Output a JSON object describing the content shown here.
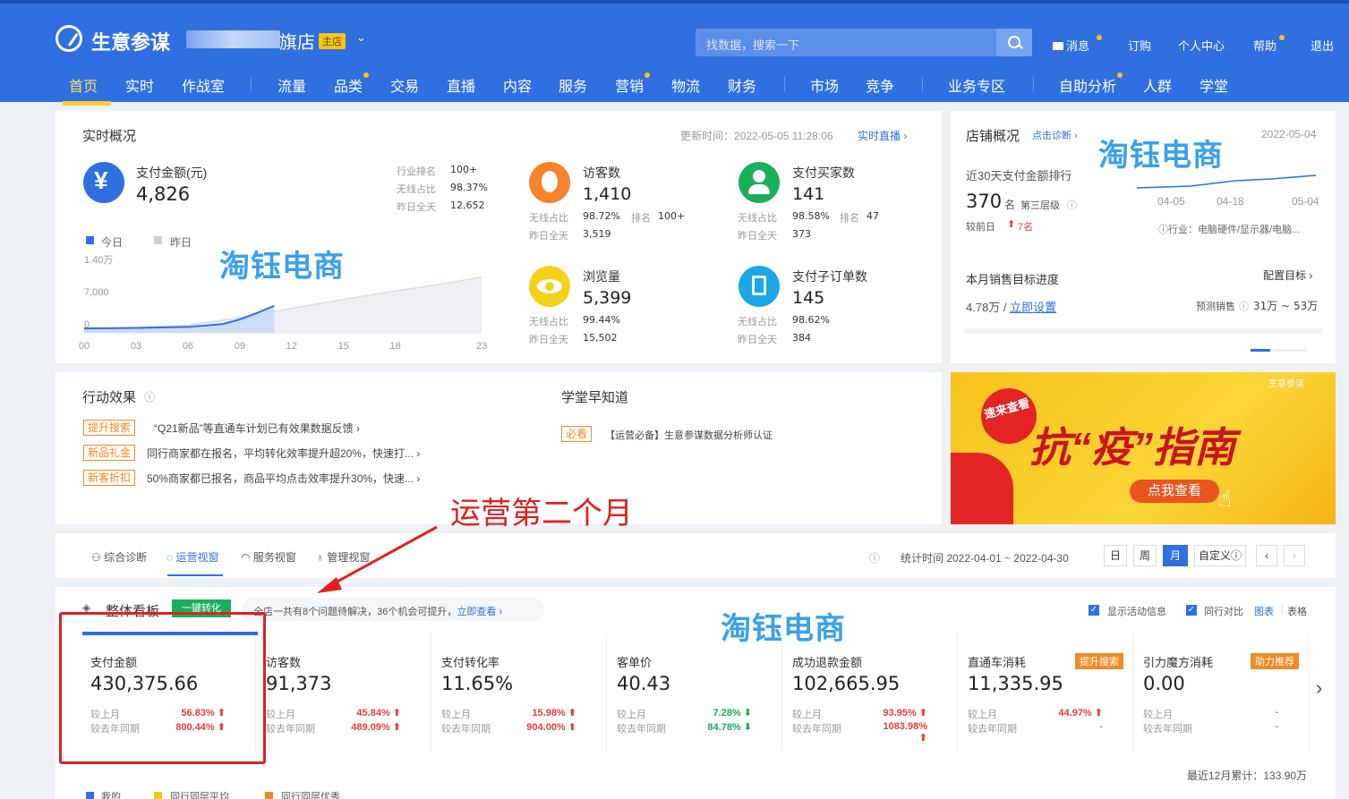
{
  "header": {
    "brand": "生意参谋",
    "shop_name": "旗店",
    "shop_badge": "主店",
    "search_placeholder": "找数据，搜索一下",
    "links": [
      "消息",
      "订购",
      "个人中心",
      "帮助",
      "退出"
    ]
  },
  "nav": [
    "首页",
    "实时",
    "作战室",
    "流量",
    "品类",
    "交易",
    "直播",
    "内容",
    "服务",
    "营销",
    "物流",
    "财务",
    "市场",
    "竞争",
    "业务专区",
    "自助分析",
    "人群",
    "学堂"
  ],
  "realtime": {
    "title": "实时概况",
    "update_label": "更新时间：2022-05-05 11:28:06",
    "live_link": "实时直播 ›",
    "pay": {
      "label": "支付金额(元)",
      "value": "4,826",
      "r1k": "行业排名",
      "r1v": "100+",
      "r2k": "无线占比",
      "r2v": "98.37%",
      "r3k": "昨日全天",
      "r3v": "12,652"
    },
    "legend_today": "今日",
    "legend_yesterday": "昨日",
    "visitors": {
      "label": "访客数",
      "value": "1,410",
      "k1": "无线占比",
      "v1": "98.72%",
      "k2": "排名",
      "v2": "100+",
      "k3": "昨日全天",
      "v3": "3,519"
    },
    "buyers": {
      "label": "支付买家数",
      "value": "141",
      "k1": "无线占比",
      "v1": "98.58%",
      "k2": "排名",
      "v2": "47",
      "k3": "昨日全天",
      "v3": "373"
    },
    "views": {
      "label": "浏览量",
      "value": "5,399",
      "k1": "无线占比",
      "v1": "99.44%",
      "k3": "昨日全天",
      "v3": "15,502"
    },
    "orders": {
      "label": "支付子订单数",
      "value": "145",
      "k1": "无线占比",
      "v1": "98.62%",
      "k3": "昨日全天",
      "v3": "384"
    }
  },
  "chart_data": {
    "type": "area",
    "x_ticks": [
      "00",
      "03",
      "06",
      "09",
      "12",
      "15",
      "18",
      "23"
    ],
    "y_ticks": [
      "1.40万",
      "7,000",
      "0"
    ],
    "series": [
      {
        "name": "今日",
        "color": "#2f6fe0",
        "x": [
          0,
          3,
          6,
          8,
          9,
          10,
          11
        ],
        "y": [
          0,
          100,
          300,
          900,
          1900,
          3300,
          4826
        ]
      },
      {
        "name": "昨日",
        "color": "#d8dde6",
        "x": [
          0,
          3,
          6,
          9,
          12,
          15,
          18,
          21,
          23
        ],
        "y": [
          0,
          200,
          700,
          2300,
          4300,
          6200,
          8000,
          9700,
          11000
        ]
      }
    ]
  },
  "shop": {
    "title": "店铺概况",
    "diag_link": "点击诊断 ›",
    "date": "2022-05-04",
    "rank_label": "近30天支付金额排行",
    "rank_value": "370",
    "rank_unit": "名",
    "tier": "第三层级",
    "prev_label": "较前日",
    "prev_change": "7名",
    "x_ticks": [
      "04-05",
      "04-18",
      "05-04"
    ],
    "industry": "行业：电脑硬件/显示器/电脑...",
    "goal_title": "本月销售目标进度",
    "goal_config": "配置目标 ›",
    "goal_value": "4.78万 / ",
    "goal_link": "立即设置",
    "forecast_label": "预测销售",
    "forecast_value": "31万 ~ 53万"
  },
  "actions": {
    "title": "行动效果",
    "items": [
      {
        "tag": "提升搜索",
        "text": "“Q21新品”等直通车计划已有效果数据反馈 ›"
      },
      {
        "tag": "新品礼金",
        "text": "同行商家都在报名，平均转化效率提升超20%，快速打... ›"
      },
      {
        "tag": "新客折扣",
        "text": "50%商家都已报名，商品平均点击效率提升30%，快速... ›"
      }
    ]
  },
  "school": {
    "title": "学堂早知道",
    "tag": "必看",
    "text": "【运营必备】生意参谋数据分析师认证"
  },
  "banner": {
    "brand": "生意参谋",
    "burst": "速来查看",
    "title": "抗“疫”指南",
    "cta": "点我查看"
  },
  "watermark": "淘钰电商",
  "annotation": "运营第二个月",
  "tabs": [
    "综合诊断",
    "运营视窗",
    "服务视窗",
    "管理视窗"
  ],
  "stat": {
    "label": "统计时间 2022-04-01 ~ 2022-04-30",
    "buttons": [
      "日",
      "周",
      "月",
      "自定义"
    ]
  },
  "board": {
    "title": "整体看板",
    "convert": "一键转化",
    "notice": "全店一共有8个问题待解决，36个机会可提升，",
    "notice_link": "立即查看 ›",
    "opt1": "显示活动信息",
    "opt2": "同行对比",
    "view_chart": "图表",
    "view_table": "表格",
    "footer": "最近12月累计：133.90万",
    "legend": [
      "我的",
      "同行同层平均",
      "同行同层优秀"
    ],
    "kpis": [
      {
        "label": "支付金额",
        "value": "430,375.66",
        "m": "56.83%",
        "md": "up",
        "y": "800.44%",
        "yd": "up"
      },
      {
        "label": "访客数",
        "value": "91,373",
        "m": "45.84%",
        "md": "up",
        "y": "489.09%",
        "yd": "up"
      },
      {
        "label": "支付转化率",
        "value": "11.65%",
        "m": "15.98%",
        "md": "up",
        "y": "904.00%",
        "yd": "up"
      },
      {
        "label": "客单价",
        "value": "40.43",
        "m": "7.28%",
        "md": "down",
        "y": "84.78%",
        "yd": "down"
      },
      {
        "label": "成功退款金额",
        "value": "102,665.95",
        "m": "93.95%",
        "md": "up",
        "y": "1083.98%",
        "yd": "up"
      },
      {
        "label": "直通车消耗",
        "value": "11,335.95",
        "m": "44.97%",
        "md": "up",
        "y": "-",
        "yd": "",
        "badge": "提升搜索"
      },
      {
        "label": "引力魔方消耗",
        "value": "0.00",
        "m": "-",
        "md": "",
        "y": "-",
        "yd": "",
        "badge": "助力推荐"
      }
    ],
    "cmp_month": "较上月",
    "cmp_year": "较去年同期"
  }
}
